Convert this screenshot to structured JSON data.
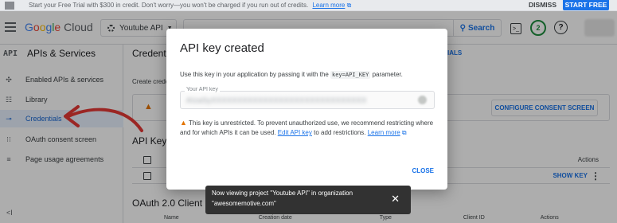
{
  "banner": {
    "message": "Start your Free Trial with $300 in credit. Don't worry—you won't be charged if you run out of credits.",
    "learn_more": "Learn more",
    "dismiss": "DISMISS",
    "start_free": "START FREE"
  },
  "header": {
    "brand_google": [
      "G",
      "o",
      "o",
      "g",
      "l",
      "e"
    ],
    "brand_cloud": "Cloud",
    "project_name": "Youtube API",
    "search_label": "Search",
    "notifications_count": "2"
  },
  "sidebar": {
    "section_badge": "API",
    "section_title": "APIs & Services",
    "items": [
      {
        "label": "Enabled APIs & services",
        "icon": "diamond-icon"
      },
      {
        "label": "Library",
        "icon": "library-icon"
      },
      {
        "label": "Credentials",
        "icon": "key-icon",
        "active": true
      },
      {
        "label": "OAuth consent screen",
        "icon": "consent-icon"
      },
      {
        "label": "Page usage agreements",
        "icon": "settings-list-icon"
      }
    ]
  },
  "main": {
    "title": "Credenti",
    "tab_right": "IALS",
    "create_text": "Create crede",
    "configure_consent": "CONFIGURE CONSENT SCREEN",
    "api_keys_title": "API Keys",
    "actions_header": "Actions",
    "show_key": "SHOW KEY",
    "oauth_title": "OAuth 2.0 Client I",
    "col_name": "Name",
    "col_creation": "Creation date",
    "col_type": "Type",
    "col_client": "Client ID",
    "col_actions": "Actions"
  },
  "dialog": {
    "title": "API key created",
    "desc_before": "Use this key in your application by passing it with the",
    "desc_code": "key=API_KEY",
    "desc_after": "parameter.",
    "key_label": "Your API key",
    "key_value": "AIzaSyXXXXXXXXXXXXXXXXXXXXXXXXXXXXXX",
    "warning_text": "This key is unrestricted. To prevent unauthorized use, we recommend restricting where and for which APIs it can be used.",
    "edit_link": "Edit API key",
    "warning_after": "to add restrictions.",
    "learn_more": "Learn more",
    "close": "CLOSE"
  },
  "toast": {
    "line1": "Now viewing project \"Youtube API\" in organization",
    "line2": "\"awesomemotive.com\""
  },
  "colors": {
    "accent": "#1a73e8",
    "warning": "#e37400",
    "annotation": "#e53935"
  }
}
